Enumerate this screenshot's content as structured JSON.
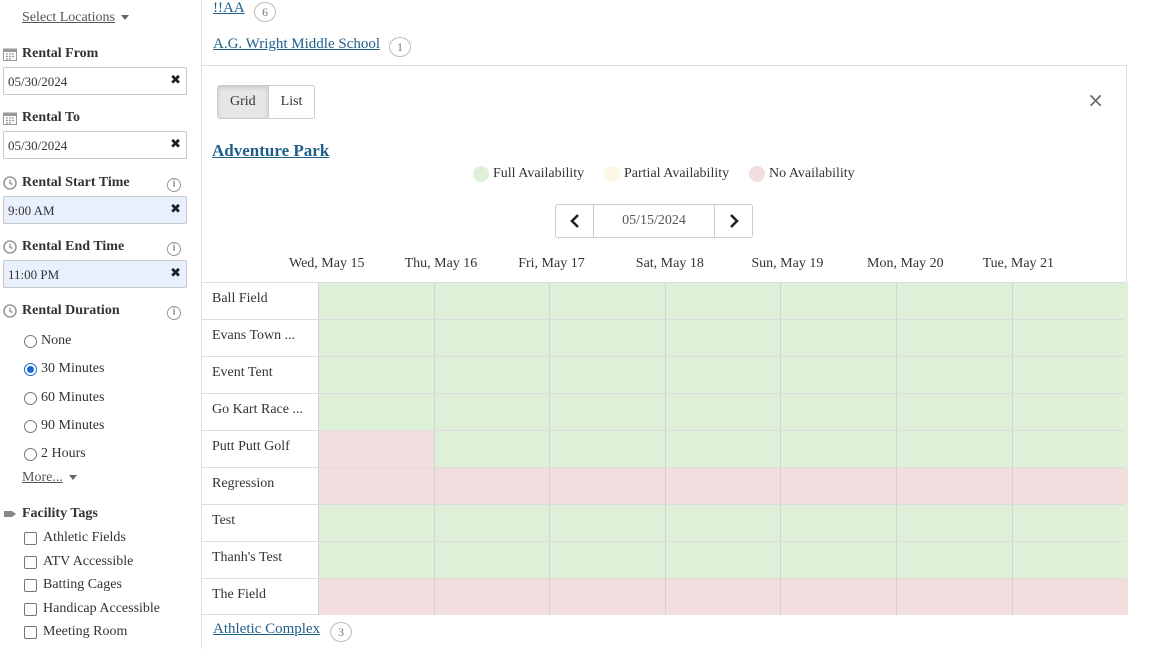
{
  "sidebar": {
    "select_locations": "Select Locations",
    "rental_from": {
      "label": "Rental From",
      "value": "05/30/2024"
    },
    "rental_to": {
      "label": "Rental To",
      "value": "05/30/2024"
    },
    "start_time": {
      "label": "Rental Start Time",
      "value": "9:00 AM"
    },
    "end_time": {
      "label": "Rental End Time",
      "value": "11:00 PM"
    },
    "duration": {
      "label": "Rental Duration",
      "options": [
        "None",
        "30 Minutes",
        "60 Minutes",
        "90 Minutes",
        "2 Hours"
      ],
      "selected": "30 Minutes",
      "more": "More..."
    },
    "clear_symbol": "✖",
    "info_symbol": "i",
    "facility_tags": {
      "label": "Facility Tags",
      "items": [
        "Athletic Fields",
        "ATV Accessible",
        "Batting Cages",
        "Handicap Accessible",
        "Meeting Room"
      ]
    }
  },
  "locations": [
    {
      "name": "!!AA",
      "count": "6"
    },
    {
      "name": "A.G. Wright Middle School",
      "count": "1"
    },
    {
      "name": "Athletic Complex",
      "count": "3"
    }
  ],
  "panel": {
    "view_tabs": [
      "Grid",
      "List"
    ],
    "active_tab": "Grid",
    "close_symbol": "×",
    "facility_title": "Adventure Park",
    "legend": [
      {
        "label": "Full Availability",
        "color": "#dff0d8"
      },
      {
        "label": "Partial Availability",
        "color": "#fcf8e3"
      },
      {
        "label": "No Availability",
        "color": "#f2dede"
      }
    ],
    "date": "05/15/2024",
    "days": [
      "Wed, May 15",
      "Thu, May 16",
      "Fri, May 17",
      "Sat, May 18",
      "Sun, May 19",
      "Mon, May 20",
      "Tue, May 21"
    ],
    "rows": [
      {
        "name": "Ball Field",
        "availability": [
          "full",
          "full",
          "full",
          "full",
          "full",
          "full",
          "full"
        ]
      },
      {
        "name": "Evans Town ...",
        "availability": [
          "full",
          "full",
          "full",
          "full",
          "full",
          "full",
          "full"
        ]
      },
      {
        "name": "Event Tent",
        "availability": [
          "full",
          "full",
          "full",
          "full",
          "full",
          "full",
          "full"
        ]
      },
      {
        "name": "Go Kart Race ...",
        "availability": [
          "full",
          "full",
          "full",
          "full",
          "full",
          "full",
          "full"
        ]
      },
      {
        "name": "Putt Putt Golf",
        "availability": [
          "none",
          "full",
          "full",
          "full",
          "full",
          "full",
          "full"
        ]
      },
      {
        "name": "Regression",
        "availability": [
          "none",
          "none",
          "none",
          "none",
          "none",
          "none",
          "none"
        ]
      },
      {
        "name": "Test",
        "availability": [
          "full",
          "full",
          "full",
          "full",
          "full",
          "full",
          "full"
        ]
      },
      {
        "name": "Thanh's Test",
        "availability": [
          "full",
          "full",
          "full",
          "full",
          "full",
          "full",
          "full"
        ]
      },
      {
        "name": "The Field",
        "availability": [
          "none",
          "none",
          "none",
          "none",
          "none",
          "none",
          "none"
        ]
      }
    ]
  }
}
